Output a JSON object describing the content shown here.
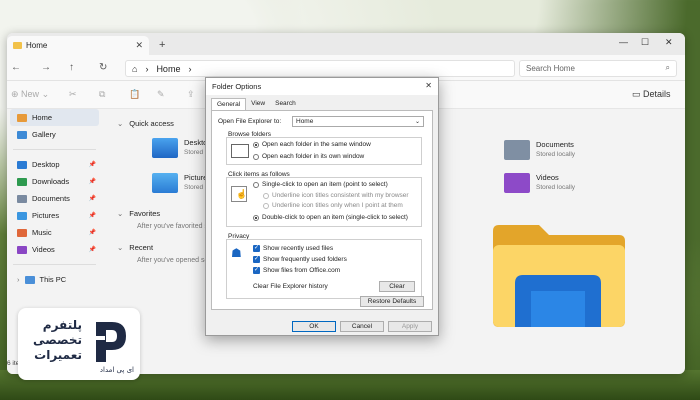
{
  "explorer": {
    "tab_title": "Home",
    "breadcrumb": "Home",
    "search_placeholder": "Search Home",
    "toolbar": {
      "new_label": "New",
      "details_label": "Details"
    },
    "sidebar": {
      "items": [
        {
          "label": "Home"
        },
        {
          "label": "Gallery"
        },
        {
          "label": "Desktop"
        },
        {
          "label": "Downloads"
        },
        {
          "label": "Documents"
        },
        {
          "label": "Pictures"
        },
        {
          "label": "Music"
        },
        {
          "label": "Videos"
        },
        {
          "label": "This PC"
        }
      ]
    },
    "main": {
      "quick_access": "Quick access",
      "favorites": "Favorites",
      "favorites_empty": "After you've favorited s",
      "recent": "Recent",
      "recent_empty": "After you've opened so",
      "files": [
        {
          "name": "Desktop",
          "sub": "Stored"
        },
        {
          "name": "Pictures",
          "sub": "Stored"
        },
        {
          "name": "Documents",
          "sub": "Stored locally"
        },
        {
          "name": "Videos",
          "sub": "Stored locally"
        }
      ]
    },
    "status": "6 item"
  },
  "dialog": {
    "title": "Folder Options",
    "tabs": [
      "General",
      "View",
      "Search"
    ],
    "open_to_label": "Open File Explorer to:",
    "open_to_value": "Home",
    "browse_group": "Browse folders",
    "browse_same": "Open each folder in the same window",
    "browse_own": "Open each folder in its own window",
    "click_group": "Click items as follows",
    "single_click": "Single-click to open an item (point to select)",
    "underline_browser": "Underline icon titles consistent with my browser",
    "underline_point": "Underline icon titles only when I point at them",
    "double_click": "Double-click to open an item (single-click to select)",
    "privacy_group": "Privacy",
    "show_recent": "Show recently used files",
    "show_frequent": "Show frequently used folders",
    "show_office": "Show files from Office.com",
    "clear_history": "Clear File Explorer history",
    "clear_btn": "Clear",
    "restore_btn": "Restore Defaults",
    "ok_btn": "OK",
    "cancel_btn": "Cancel",
    "apply_btn": "Apply"
  },
  "brand": {
    "line1": "پلتفرم",
    "line2": "تخصصی",
    "line3": "تعمیرات",
    "sub": "ای پی امداد"
  }
}
